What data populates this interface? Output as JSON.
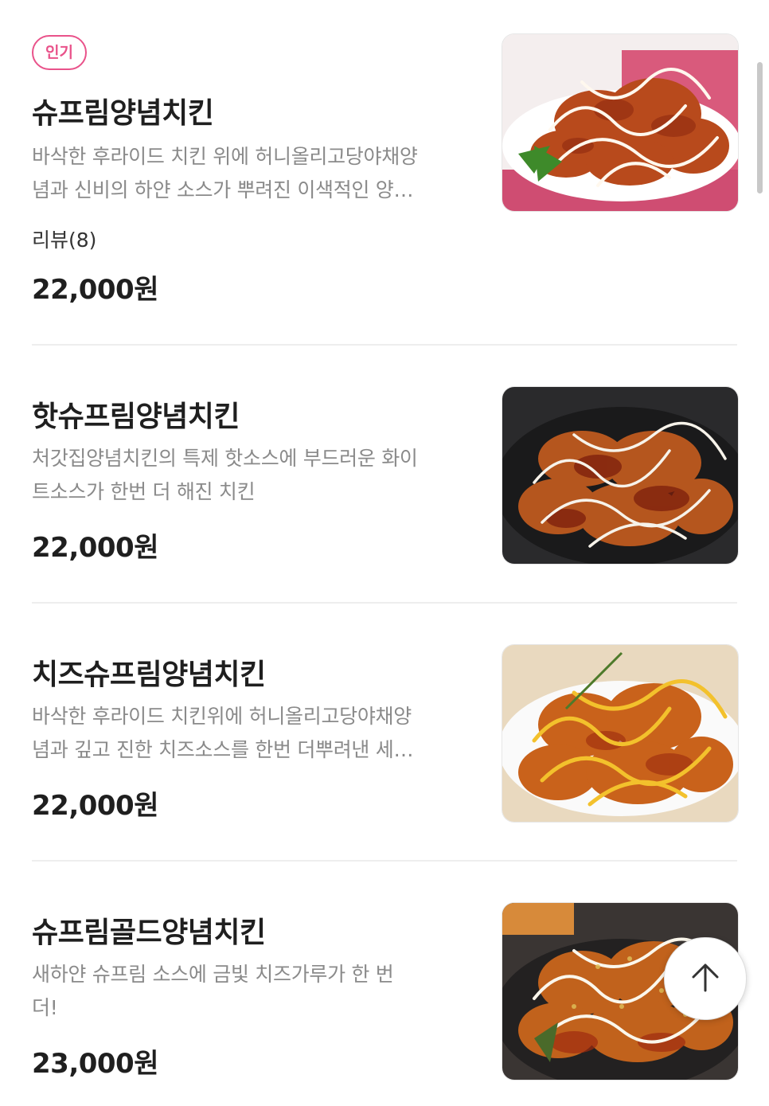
{
  "menu": {
    "items": [
      {
        "badge": "인기",
        "title": "슈프림양념치킨",
        "desc_line1": "바삭한 후라이드 치킨 위에 허니올리고당야채양",
        "desc_line2": "념과 신비의 하얀 소스가 뿌려진 이색적인 양…",
        "review": "리뷰(8)",
        "price": "22,000원",
        "image": "chicken-plate-red-sauce-white-drizzle"
      },
      {
        "title": "핫슈프림양념치킨",
        "desc_line1": "처갓집양념치킨의 특제 핫소스에 부드러운 화이",
        "desc_line2": "트소스가 한번 더 해진 치킨",
        "price": "22,000원",
        "image": "chicken-black-pan-hot-sauce"
      },
      {
        "title": "치즈슈프림양념치킨",
        "desc_line1": "바삭한 후라이드 치킨위에 허니올리고당야채양",
        "desc_line2": "념과 깊고 진한 치즈소스를 한번 더뿌려낸 세…",
        "price": "22,000원",
        "image": "chicken-plate-cheese-sauce"
      },
      {
        "title": "슈프림골드양념치킨",
        "desc_line1": "새하얀 슈프림 소스에 금빛 치즈가루가 한 번",
        "desc_line2": "더!",
        "price": "23,000원",
        "image": "chicken-gold-cheese-powder"
      }
    ]
  },
  "scroll_top_button": {
    "icon": "arrow-up-icon"
  },
  "colors": {
    "badge": "#e9528a",
    "title": "#1f1f1f",
    "description": "#8a8a8a",
    "divider": "#eeeeee"
  }
}
